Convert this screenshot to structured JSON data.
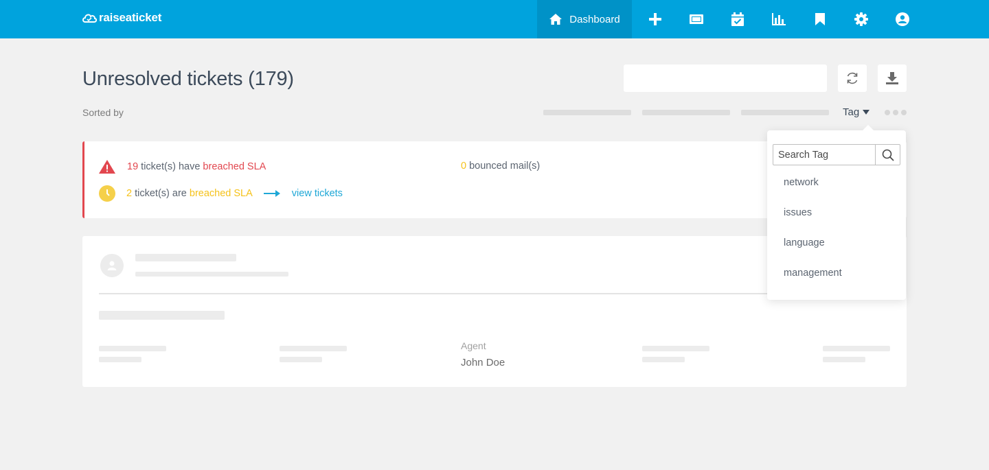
{
  "topbar": {
    "logo": "raiseaticket",
    "nav_dashboard_label": "Dashboard",
    "nav_icons": [
      "plus-icon",
      "ticket-icon",
      "calendar-check-icon",
      "bar-chart-icon",
      "bookmark-icon",
      "gear-icon",
      "user-circle-icon"
    ]
  },
  "header": {
    "title": "Unresolved tickets (179)",
    "search_value": "",
    "sorted_by_label": "Sorted by",
    "sort_tag_label": "Tag"
  },
  "alerts": {
    "breached_count": "19",
    "breached_text": " ticket(s) have ",
    "breached_link": "breached SLA",
    "bounced_count": "0",
    "bounced_text": " bounced mail(s)",
    "due_count": "2",
    "due_text": " ticket(s) are ",
    "due_link": "breached SLA",
    "view_tickets": "view tickets"
  },
  "ticket_card": {
    "agent_label": "Agent",
    "agent_name": "John Doe"
  },
  "tag_dropdown": {
    "search_placeholder": "Search Tag",
    "items": [
      "network",
      "issues",
      "language",
      "management"
    ]
  },
  "colors": {
    "topbar": "#00a3dd",
    "active_nav": "#0092c7",
    "danger": "#e2474f",
    "warning": "#f5c21b",
    "link": "#1ea7d6"
  }
}
